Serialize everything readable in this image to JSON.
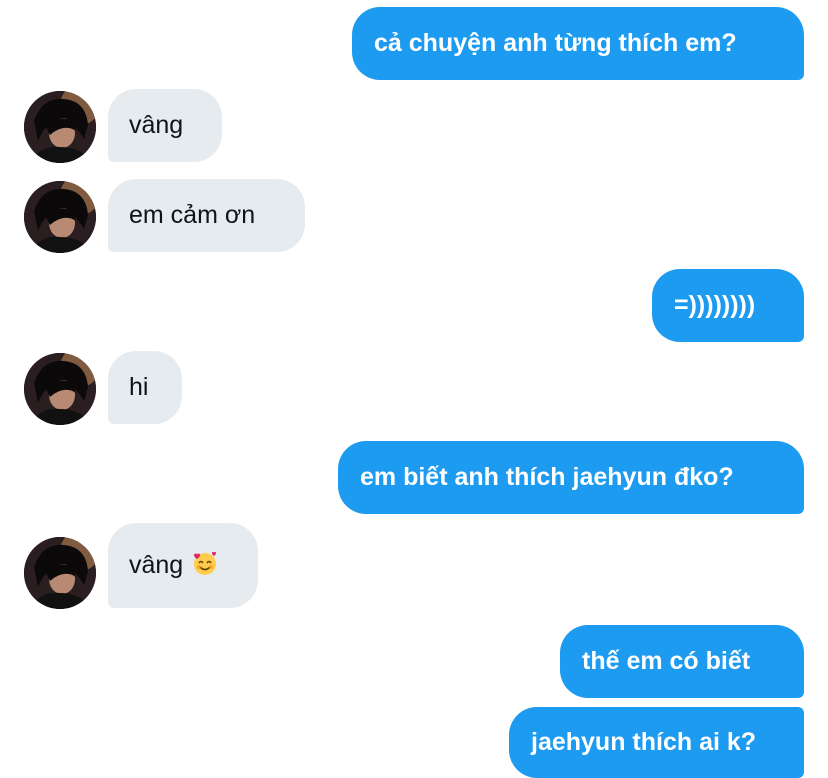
{
  "messages": [
    {
      "side": "sent",
      "text": "cả chuyện anh từng thích em?"
    },
    {
      "side": "received",
      "text": "vâng"
    },
    {
      "side": "received",
      "text": "em cảm ơn"
    },
    {
      "side": "sent",
      "text": "=))))))))"
    },
    {
      "side": "received",
      "text": "hi"
    },
    {
      "side": "sent",
      "text": "em biết anh thích jaehyun đko?"
    },
    {
      "side": "received",
      "text": "vâng",
      "emoji": "smiling-face-with-hearts"
    },
    {
      "side": "sent",
      "text": "thế em có biết"
    },
    {
      "side": "sent",
      "text": "jaehyun thích ai k?"
    }
  ],
  "colors": {
    "sent_bubble": "#1d9bf0",
    "sent_text": "#ffffff",
    "received_bubble": "#e6ebef",
    "received_text": "#0f1419"
  }
}
